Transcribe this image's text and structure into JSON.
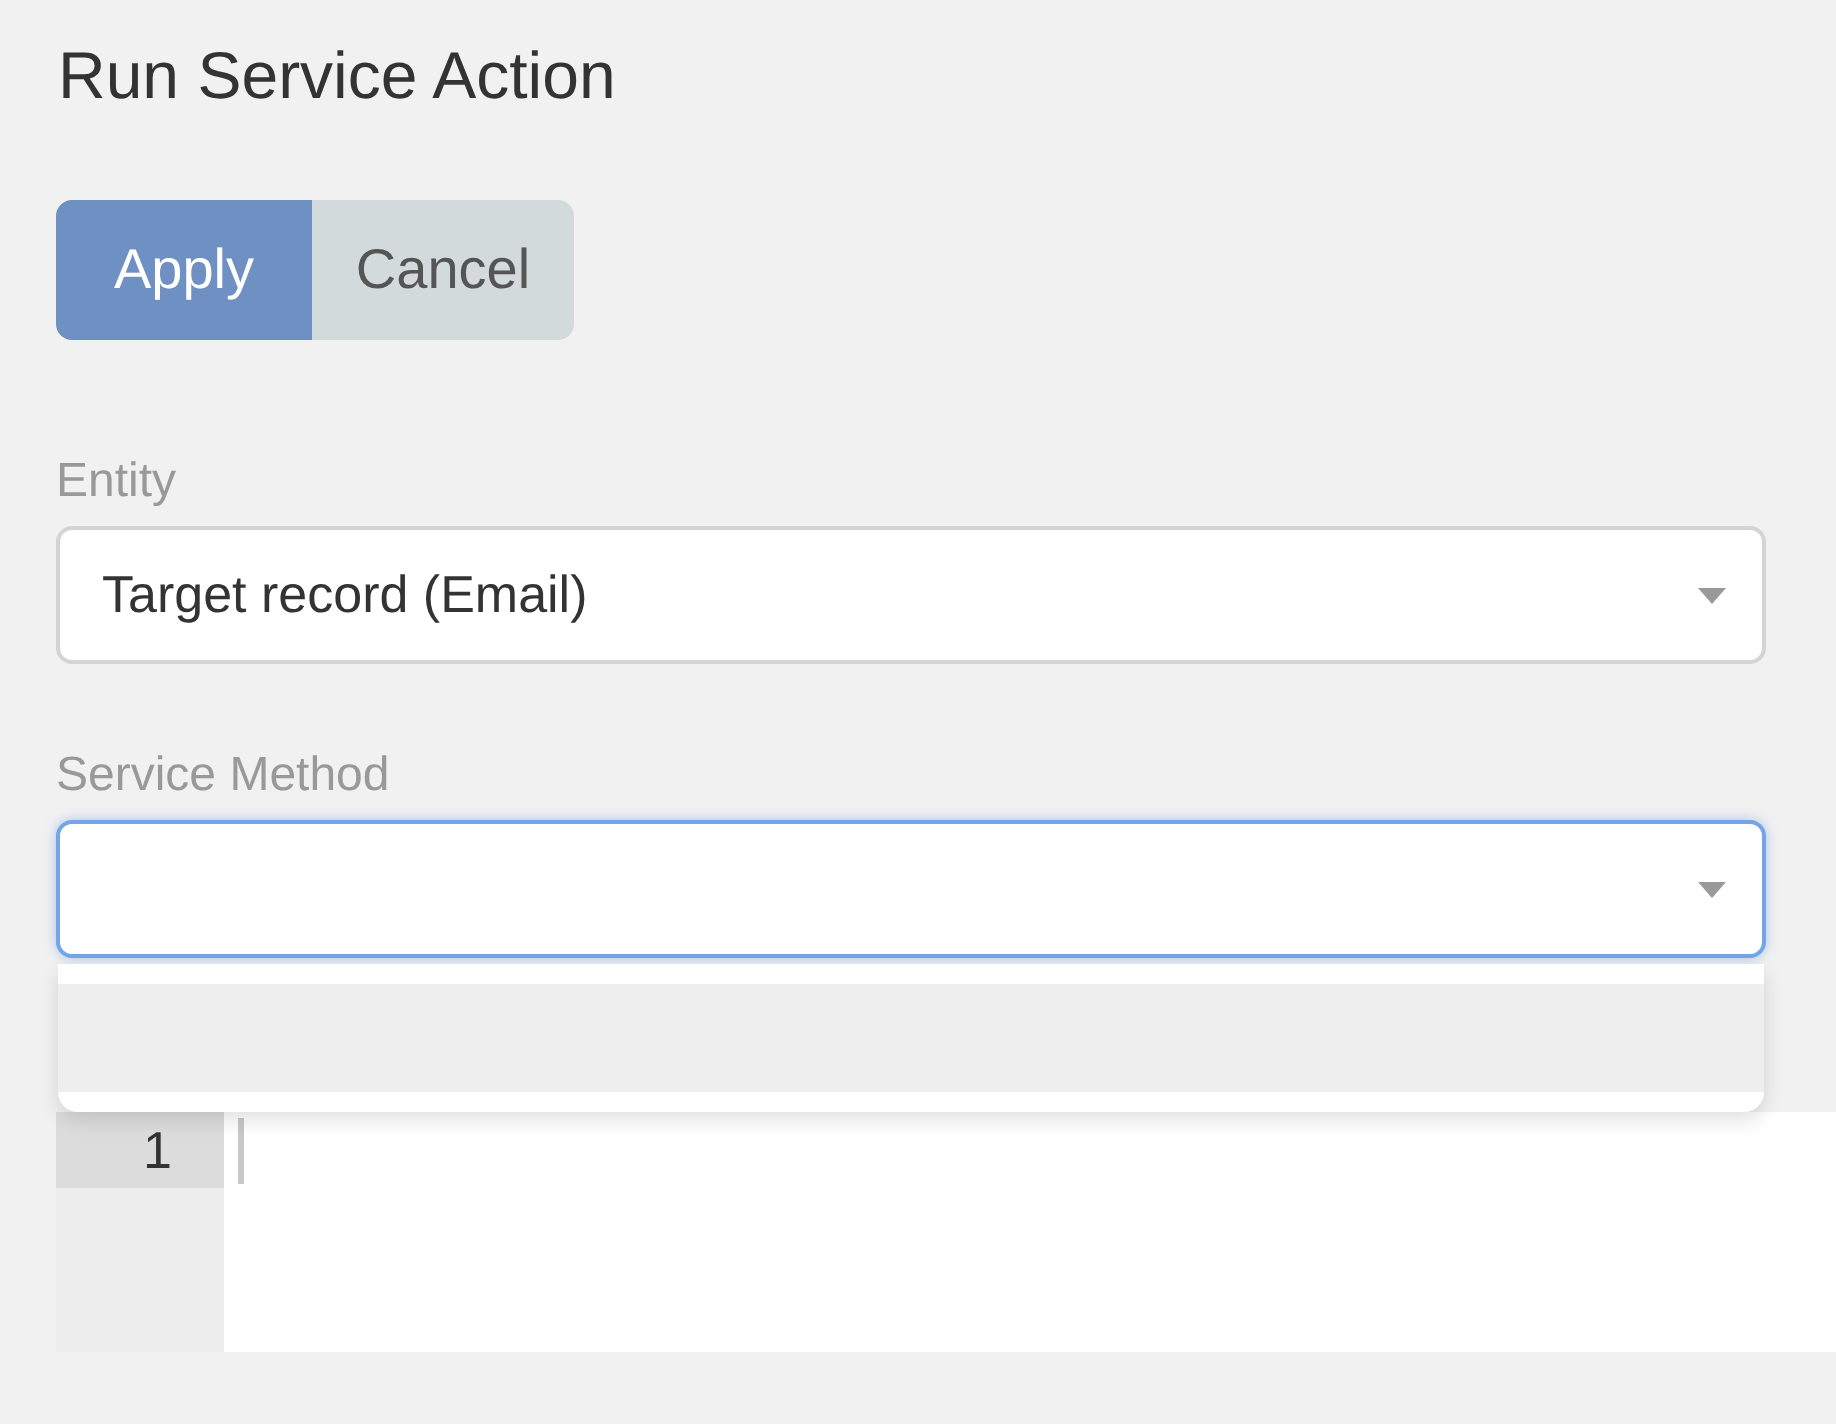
{
  "title": "Run Service Action",
  "buttons": [
    {
      "label": "Apply",
      "kind": "primary"
    },
    {
      "label": "Cancel",
      "kind": "secondary"
    }
  ],
  "fields": [
    {
      "kind": "select",
      "label": "Entity",
      "value": "Target record (Email)",
      "focused": false
    },
    {
      "kind": "select",
      "label": "Service Method",
      "focused": true,
      "dropdown": {
        "options": [
          {
            "highlighted": true
          }
        ]
      }
    }
  ],
  "editor": {
    "lines": [
      {
        "number": "1",
        "active": true
      }
    ],
    "cursor": true
  }
}
